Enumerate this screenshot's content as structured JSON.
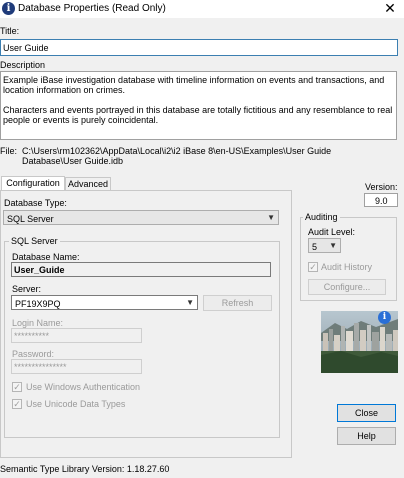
{
  "window": {
    "title": "Database Properties (Read Only)",
    "close_glyph": "✕",
    "icon": "info-icon"
  },
  "fields": {
    "title_label": "Title:",
    "title_value": "User Guide",
    "description_label": "Description",
    "description_p1": "Example iBase investigation database with timeline information on events and transactions, and location information on crimes.",
    "description_p2": "Characters and events portrayed in this database are totally fictitious and any resemblance to real people or events is purely coincidental.",
    "file_label": "File:",
    "file_path": "C:\\Users\\rm102362\\AppData\\Local\\i2\\i2 iBase 8\\en-US\\Examples\\User Guide Database\\User Guide.idb"
  },
  "tabs": [
    {
      "label": "Configuration",
      "active": true
    },
    {
      "label": "Advanced",
      "active": false
    }
  ],
  "version": {
    "label": "Version:",
    "value": "9.0"
  },
  "configuration": {
    "db_type_label": "Database Type:",
    "db_type_value": "SQL Server",
    "sql_group_label": "SQL Server",
    "db_name_label": "Database Name:",
    "db_name_value": "User_Guide",
    "server_label": "Server:",
    "server_value": "PF19X9PQ",
    "refresh_label": "Refresh",
    "login_label": "Login Name:",
    "login_value": "**********",
    "password_label": "Password:",
    "password_value": "***************",
    "win_auth_label": "Use Windows Authentication",
    "unicode_label": "Use Unicode Data Types"
  },
  "auditing": {
    "group_label": "Auditing",
    "level_label": "Audit Level:",
    "level_value": "5",
    "audit_history_label": "Audit History",
    "configure_label": "Configure..."
  },
  "buttons": {
    "close": "Close",
    "help": "Help"
  },
  "footer": {
    "semantic_version": "Semantic Type Library Version: 1.18.27.60"
  },
  "colors": {
    "window_bg": "#f0f0f0",
    "focus_border": "#3c7fb1",
    "title_icon": "#1f3b7a",
    "info_badge": "#2a6fd6"
  }
}
